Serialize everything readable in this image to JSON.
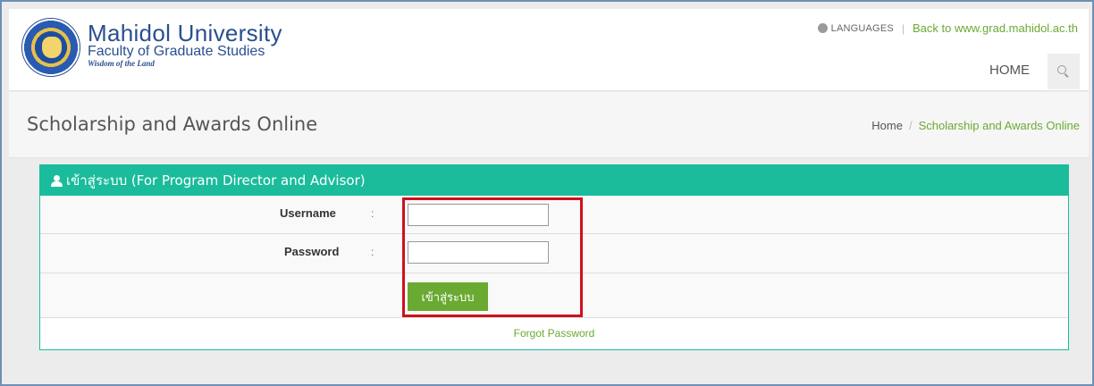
{
  "header": {
    "logo": {
      "title": "Mahidol University",
      "subtitle": "Faculty of Graduate Studies",
      "motto": "Wisdom of the Land"
    },
    "top_links": {
      "languages_label": "LANGUAGES",
      "separator": "|",
      "back_link": "Back to www.grad.mahidol.ac.th"
    },
    "nav": {
      "home_label": "HOME"
    }
  },
  "title_bar": {
    "page_title": "Scholarship and Awards Online",
    "breadcrumb": {
      "home": "Home",
      "separator": "/",
      "current": "Scholarship and Awards Online"
    }
  },
  "login_panel": {
    "heading": "เข้าสู่ระบบ (For Program Director and Advisor)",
    "username_label": "Username",
    "password_label": "Password",
    "colon": ":",
    "username_value": "",
    "password_value": "",
    "submit_label": "เข้าสู่ระบบ",
    "forgot_label": "Forgot Password"
  },
  "colors": {
    "panel_accent": "#1abc9c",
    "link_green": "#6aaa32",
    "highlight_red": "#d0101b",
    "brand_blue": "#2a4f8f"
  },
  "icons": [
    "university-seal-icon",
    "globe-icon",
    "search-icon",
    "user-icon"
  ]
}
